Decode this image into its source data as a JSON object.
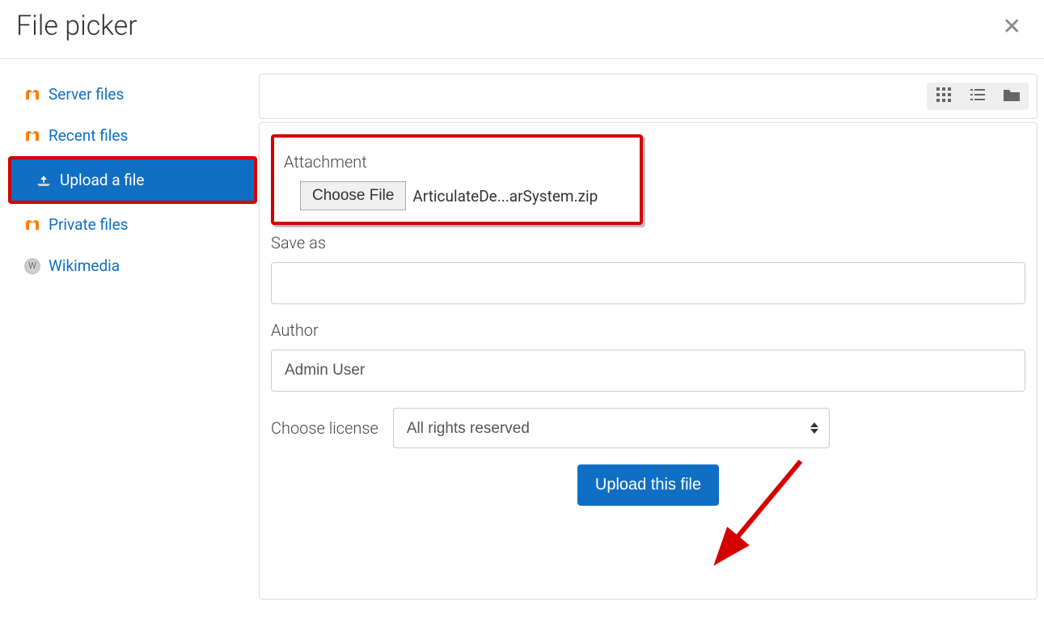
{
  "header": {
    "title": "File picker"
  },
  "sidebar": {
    "items": [
      {
        "label": "Server files",
        "icon": "moodle"
      },
      {
        "label": "Recent files",
        "icon": "moodle"
      },
      {
        "label": "Upload a file",
        "icon": "upload",
        "active": true
      },
      {
        "label": "Private files",
        "icon": "moodle"
      },
      {
        "label": "Wikimedia",
        "icon": "wiki"
      }
    ]
  },
  "form": {
    "attachment": {
      "label": "Attachment",
      "button": "Choose File",
      "filename": "ArticulateDe...arSystem.zip"
    },
    "save_as": {
      "label": "Save as",
      "value": ""
    },
    "author": {
      "label": "Author",
      "value": "Admin User"
    },
    "license": {
      "label": "Choose license",
      "selected": "All rights reserved"
    },
    "submit": "Upload this file"
  }
}
